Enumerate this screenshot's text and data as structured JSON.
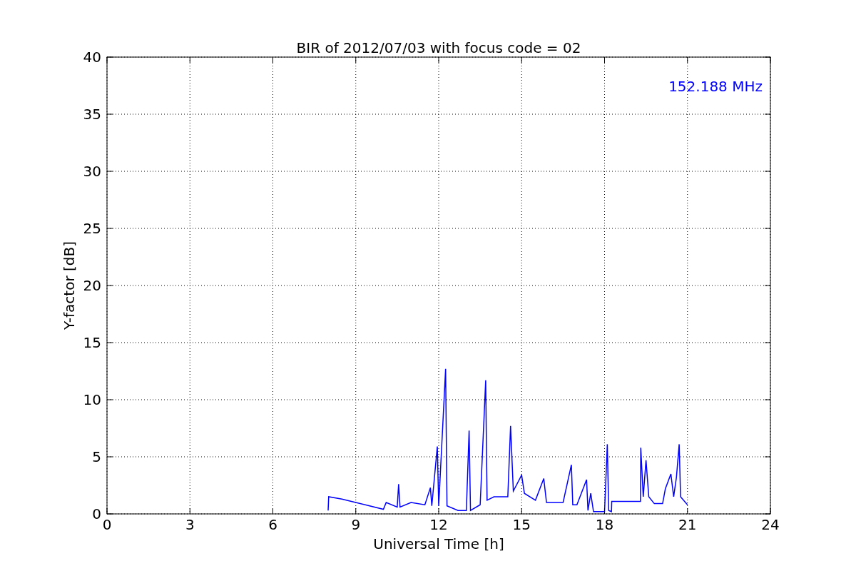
{
  "chart_data": {
    "type": "line",
    "title": "BIR of 2012/07/03 with focus code = 02",
    "xlabel": "Universal Time [h]",
    "ylabel": "Y-factor [dB]",
    "xlim": [
      0,
      24
    ],
    "ylim": [
      0,
      40
    ],
    "xticks": [
      0,
      3,
      6,
      9,
      12,
      15,
      18,
      21,
      24
    ],
    "yticks": [
      0,
      5,
      10,
      15,
      20,
      25,
      30,
      35,
      40
    ],
    "x": [
      8.0,
      8.02,
      8.5,
      9.0,
      9.5,
      10.0,
      10.1,
      10.5,
      10.55,
      10.6,
      11.0,
      11.5,
      11.7,
      11.75,
      11.95,
      12.0,
      12.25,
      12.3,
      12.7,
      13.0,
      13.1,
      13.15,
      13.5,
      13.7,
      13.75,
      14.0,
      14.5,
      14.6,
      14.7,
      15.0,
      15.1,
      15.5,
      15.8,
      15.9,
      16.5,
      16.8,
      16.85,
      17.0,
      17.35,
      17.4,
      17.5,
      17.6,
      18.0,
      18.1,
      18.15,
      18.25,
      18.26,
      19.3,
      19.31,
      19.4,
      19.5,
      19.6,
      19.8,
      20.1,
      20.2,
      20.4,
      20.5,
      20.6,
      20.7,
      20.75,
      21.0
    ],
    "series": [
      {
        "name": "152.188 MHz",
        "color": "#0000ff",
        "values": [
          0.3,
          1.5,
          1.3,
          1.0,
          0.7,
          0.4,
          1.0,
          0.6,
          2.6,
          0.6,
          1.0,
          0.8,
          2.3,
          0.7,
          5.9,
          0.7,
          12.7,
          0.7,
          0.3,
          0.3,
          7.3,
          0.3,
          0.8,
          11.7,
          1.2,
          1.5,
          1.5,
          7.7,
          2.0,
          3.4,
          1.8,
          1.2,
          3.1,
          1.0,
          1.0,
          4.3,
          0.8,
          0.8,
          3.0,
          0.3,
          1.8,
          0.2,
          0.2,
          6.1,
          0.3,
          0.2,
          1.1,
          1.1,
          5.8,
          1.5,
          4.7,
          1.5,
          0.9,
          0.9,
          2.2,
          3.5,
          1.5,
          3.2,
          6.1,
          1.5,
          0.8
        ]
      }
    ],
    "grid": true
  }
}
